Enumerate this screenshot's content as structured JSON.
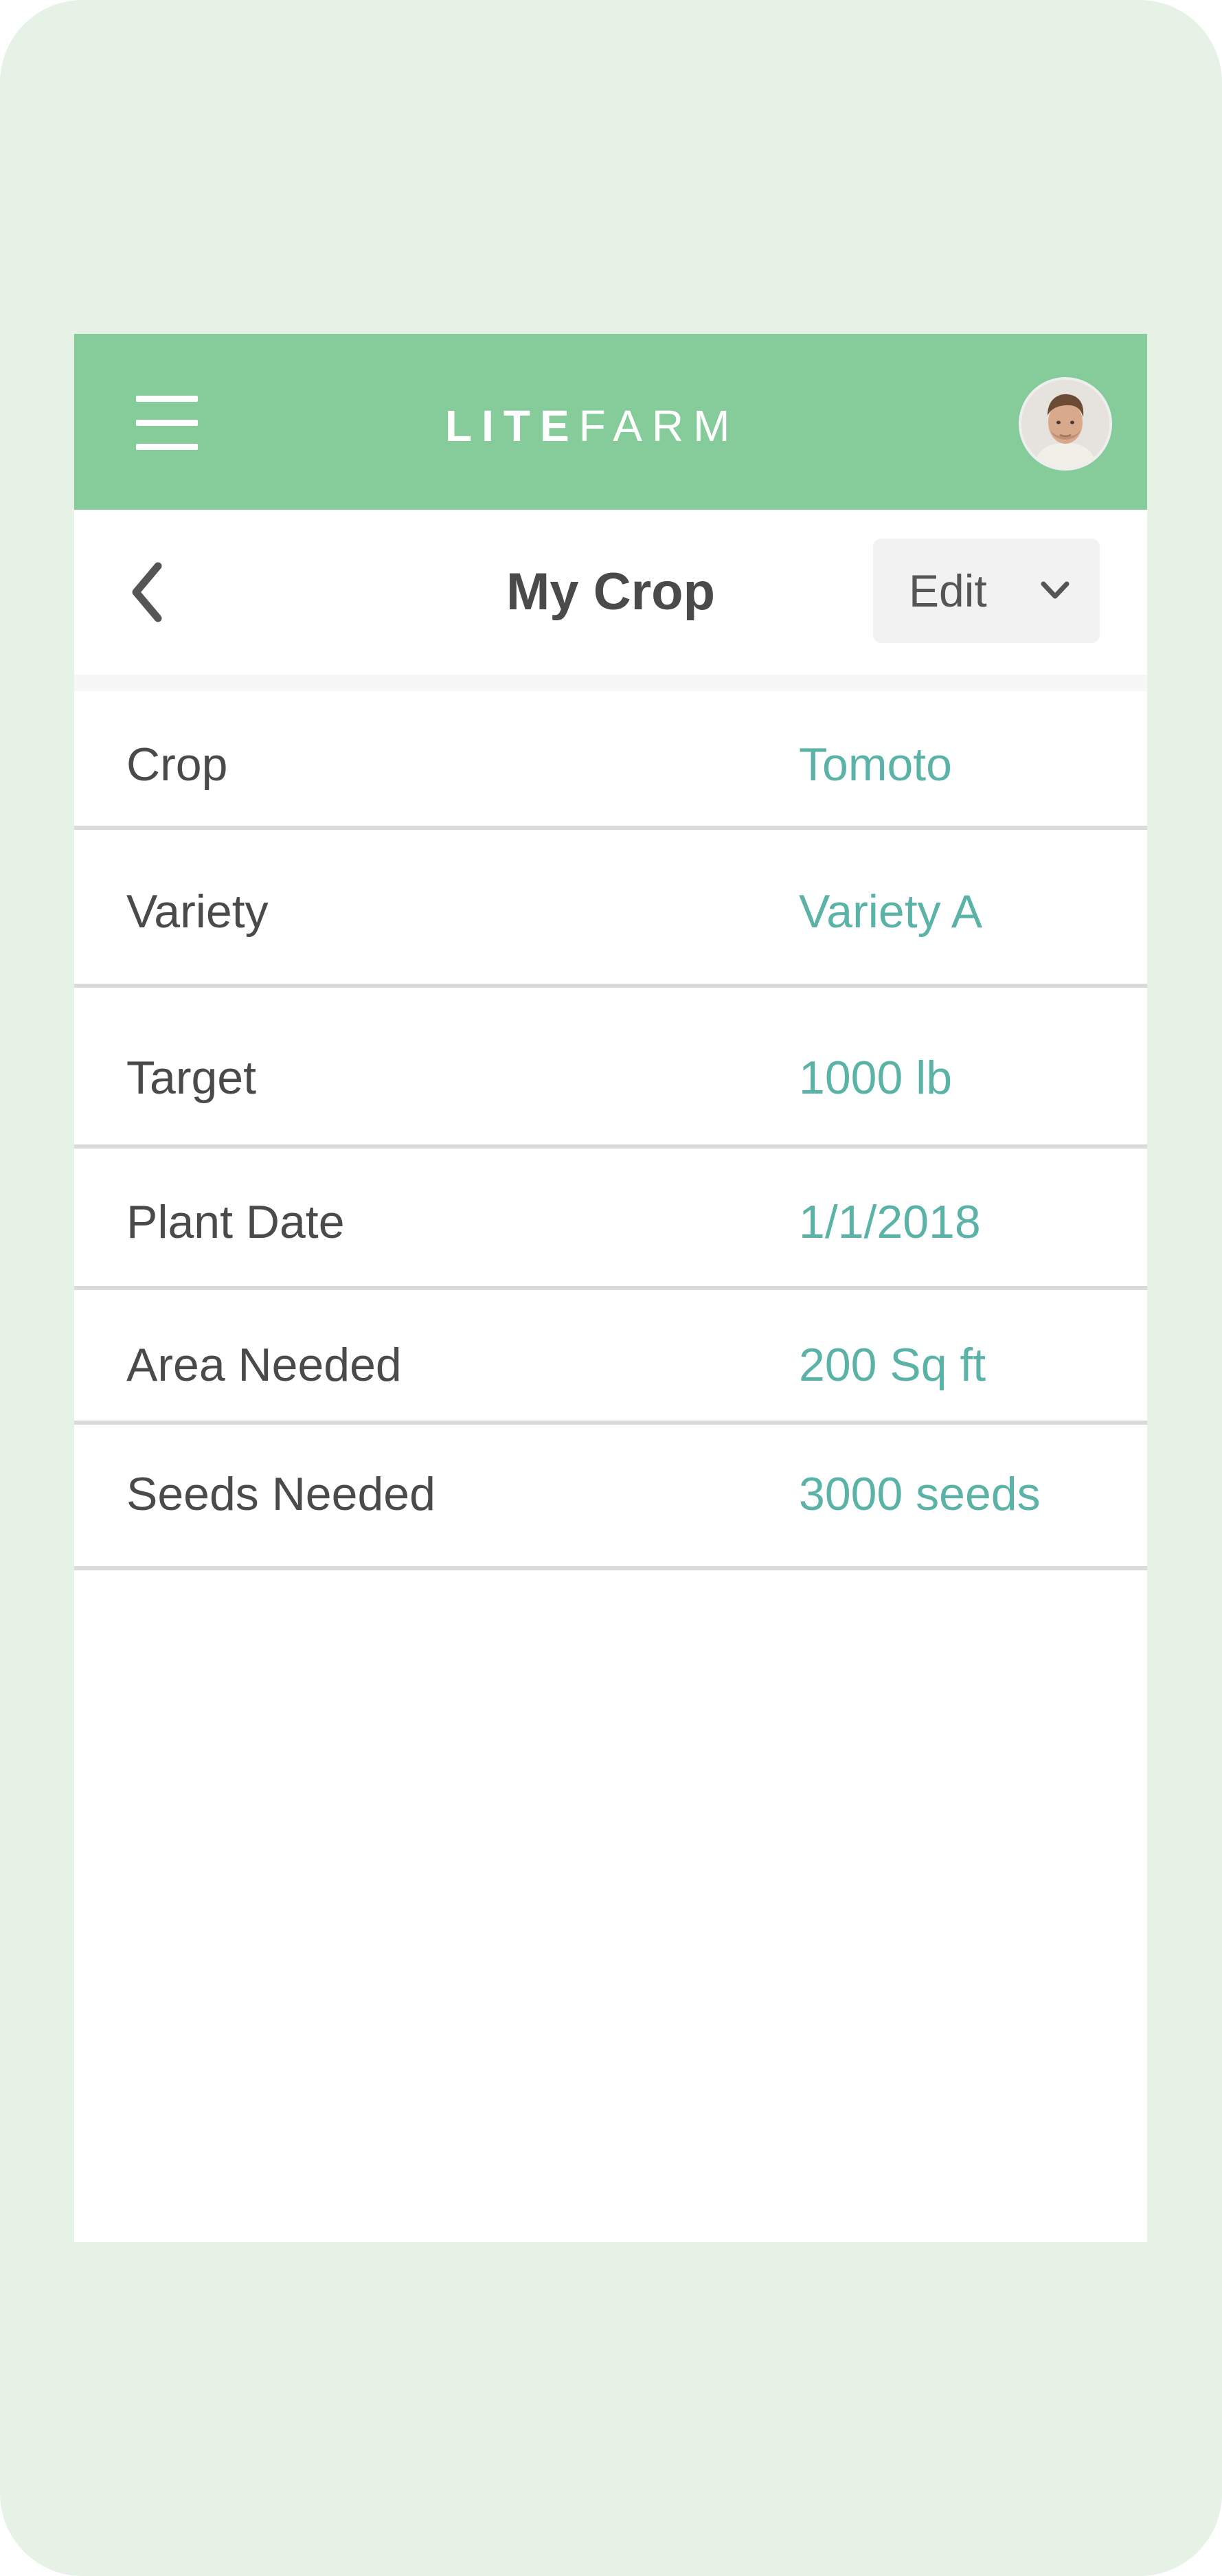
{
  "app": {
    "logo_bold": "LITE",
    "logo_light": "FARM",
    "menu_icon": "hamburger-menu-icon",
    "avatar_icon": "user-avatar"
  },
  "header": {
    "title": "My Crop",
    "back_icon": "chevron-left-icon",
    "edit_label": "Edit",
    "edit_icon": "chevron-down-icon"
  },
  "details": [
    {
      "label": "Crop",
      "value": "Tomoto"
    },
    {
      "label": "Variety",
      "value": "Variety A"
    },
    {
      "label": "Target",
      "value": "1000 lb"
    },
    {
      "label": "Plant Date",
      "value": "1/1/2018"
    },
    {
      "label": "Area Needed",
      "value": "200 Sq ft"
    },
    {
      "label": "Seeds Needed",
      "value": "3000 seeds"
    }
  ],
  "colors": {
    "topbar": "#86cc9b",
    "background": "#e7f2e7",
    "value_text": "#5ab3a6",
    "label_text": "#4a4a4a"
  }
}
